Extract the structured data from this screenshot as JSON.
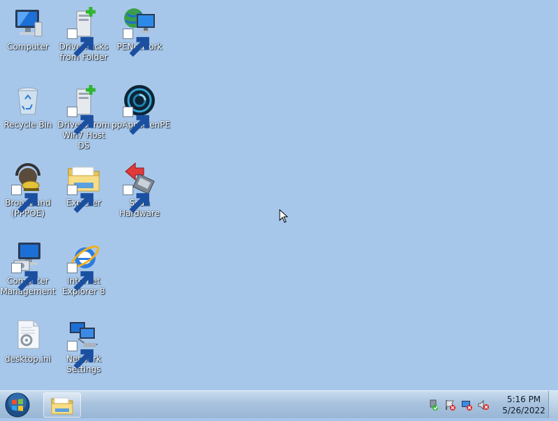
{
  "desktop": {
    "icons": [
      {
        "label": "Computer",
        "icon": "computer-icon",
        "shortcut": false
      },
      {
        "label": "DriverPacks\nfrom Folder",
        "icon": "driverpacks-icon",
        "shortcut": true
      },
      {
        "label": "PENetwork",
        "icon": "pe-network-icon",
        "shortcut": true
      },
      {
        "label": "Recycle Bin",
        "icon": "recycle-bin-icon",
        "shortcut": false
      },
      {
        "label": "Drivers from\nWin7 Host DS",
        "icon": "drivers-host-icon",
        "shortcut": true
      },
      {
        "label": "ppAppsGenPE",
        "icon": "ppappsgenpe-icon",
        "shortcut": true
      },
      {
        "label": "Broadband\n(PPPOE)",
        "icon": "broadband-icon",
        "shortcut": true
      },
      {
        "label": "Explorer",
        "icon": "folder-icon",
        "shortcut": true
      },
      {
        "label": "Scan\nHardware",
        "icon": "scan-hardware-icon",
        "shortcut": true
      },
      {
        "label": "Computer\nManagement",
        "icon": "computer-management-icon",
        "shortcut": true
      },
      {
        "label": "Internet\nExplorer 8",
        "icon": "internet-explorer-icon",
        "shortcut": true
      },
      {
        "label": "desktop.ini",
        "icon": "ini-file-icon",
        "shortcut": false
      },
      {
        "label": "Network\nSettings",
        "icon": "network-settings-icon",
        "shortcut": true
      }
    ]
  },
  "taskbar": {
    "start": "start-orb-icon",
    "pinned": [
      "explorer-folder-icon"
    ],
    "tray": [
      "usb-safely-remove-icon",
      "flag-action-center-icon",
      "network-disconnected-icon",
      "volume-muted-icon"
    ],
    "clock": {
      "time": "5:16 PM",
      "date": "5/26/2022"
    }
  },
  "colors": {
    "desktop_bg": "#a7c7ea",
    "taskbar": "#a9c3de",
    "label_text": "#ffffff"
  }
}
